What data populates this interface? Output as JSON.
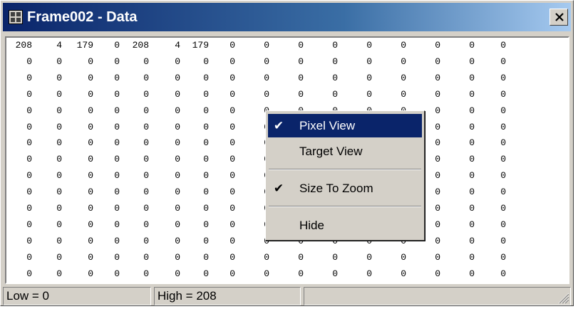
{
  "window": {
    "title": "Frame002 - Data",
    "icon": "data-grid-icon",
    "close_icon": "close-icon",
    "colors": {
      "title_active": "#0a246a",
      "title_gradient_end": "#a6caf0",
      "face": "#d4d0c8"
    }
  },
  "grid": {
    "rows": [
      [
        "208",
        "4",
        "179",
        "0",
        "208",
        "4",
        "179",
        "0",
        "0",
        "0",
        "0",
        "0",
        "0",
        "0",
        "0",
        "0"
      ],
      [
        "0",
        "0",
        "0",
        "0",
        "0",
        "0",
        "0",
        "0",
        "0",
        "0",
        "0",
        "0",
        "0",
        "0",
        "0",
        "0"
      ],
      [
        "0",
        "0",
        "0",
        "0",
        "0",
        "0",
        "0",
        "0",
        "0",
        "0",
        "0",
        "0",
        "0",
        "0",
        "0",
        "0"
      ],
      [
        "0",
        "0",
        "0",
        "0",
        "0",
        "0",
        "0",
        "0",
        "0",
        "0",
        "0",
        "0",
        "0",
        "0",
        "0",
        "0"
      ],
      [
        "0",
        "0",
        "0",
        "0",
        "0",
        "0",
        "0",
        "0",
        "0",
        "0",
        "0",
        "0",
        "0",
        "0",
        "0",
        "0"
      ],
      [
        "0",
        "0",
        "0",
        "0",
        "0",
        "0",
        "0",
        "0",
        "0",
        "0",
        "0",
        "0",
        "0",
        "0",
        "0",
        "0"
      ],
      [
        "0",
        "0",
        "0",
        "0",
        "0",
        "0",
        "0",
        "0",
        "0",
        "0",
        "0",
        "0",
        "0",
        "0",
        "0",
        "0"
      ],
      [
        "0",
        "0",
        "0",
        "0",
        "0",
        "0",
        "0",
        "0",
        "0",
        "0",
        "0",
        "0",
        "0",
        "0",
        "0",
        "0"
      ],
      [
        "0",
        "0",
        "0",
        "0",
        "0",
        "0",
        "0",
        "0",
        "0",
        "0",
        "0",
        "0",
        "0",
        "0",
        "0",
        "0"
      ],
      [
        "0",
        "0",
        "0",
        "0",
        "0",
        "0",
        "0",
        "0",
        "0",
        "0",
        "0",
        "0",
        "0",
        "0",
        "0",
        "0"
      ],
      [
        "0",
        "0",
        "0",
        "0",
        "0",
        "0",
        "0",
        "0",
        "0",
        "0",
        "0",
        "0",
        "0",
        "0",
        "0",
        "0"
      ],
      [
        "0",
        "0",
        "0",
        "0",
        "0",
        "0",
        "0",
        "0",
        "0",
        "0",
        "0",
        "0",
        "0",
        "0",
        "0",
        "0"
      ],
      [
        "0",
        "0",
        "0",
        "0",
        "0",
        "0",
        "0",
        "0",
        "0",
        "0",
        "0",
        "0",
        "0",
        "0",
        "0",
        "0"
      ],
      [
        "0",
        "0",
        "0",
        "0",
        "0",
        "0",
        "0",
        "0",
        "0",
        "0",
        "0",
        "0",
        "0",
        "0",
        "0",
        "0"
      ],
      [
        "0",
        "0",
        "0",
        "0",
        "0",
        "0",
        "0",
        "0",
        "0",
        "0",
        "0",
        "0",
        "0",
        "0",
        "0",
        "0"
      ]
    ]
  },
  "context_menu": {
    "items": [
      {
        "label": "Pixel View",
        "checked": true,
        "selected": true
      },
      {
        "label": "Target View",
        "checked": false,
        "selected": false
      },
      {
        "label": "Size To Zoom",
        "checked": true,
        "selected": false
      },
      {
        "label": "Hide",
        "checked": false,
        "selected": false
      }
    ],
    "check_glyph": "✔"
  },
  "status": {
    "low": "Low = 0",
    "high": "High = 208",
    "grip_icon": "resize-grip-icon"
  }
}
